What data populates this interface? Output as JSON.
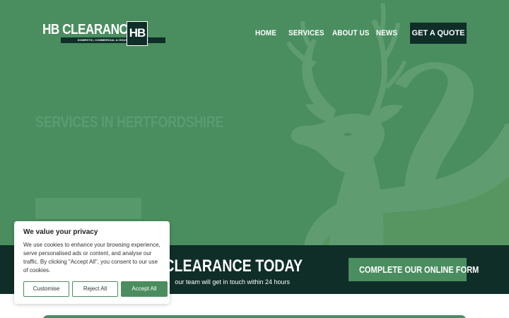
{
  "brand": {
    "name": "HB CLEARANCE",
    "tagline": "DOMESTIC, COMMERCIAL & HOUSE CLEARANCE",
    "badge": "HB"
  },
  "nav": {
    "items": [
      "HOME",
      "SERVICES",
      "ABOUT US",
      "NEWS"
    ],
    "cta_label": "GET A QUOTE"
  },
  "hero": {
    "title": "SERVICES IN HERTFORDSHIRE",
    "button_label": ""
  },
  "cta_banner": {
    "title": "ROM HB CLEARANCE TODAY",
    "subtitle": "our team will get in touch within 24 hours",
    "button_label": "COMPLETE OUR ONLINE FORM"
  },
  "cookie": {
    "title": "We value your privacy",
    "text": "We use cookies to enhance your browsing experience, serve personalised ads or content, and analyse our traffic. By clicking \"Accept All\", you consent to our use of cookies.",
    "buttons": {
      "customise": "Customise",
      "reject": "Reject All",
      "accept": "Accept All"
    }
  },
  "colors": {
    "primary_green": "#4a8d5f",
    "dark_green": "#0f2e27",
    "art_green": "#5f9d71"
  },
  "icons": {
    "hero_art": "stag-and-swan-emblem"
  }
}
